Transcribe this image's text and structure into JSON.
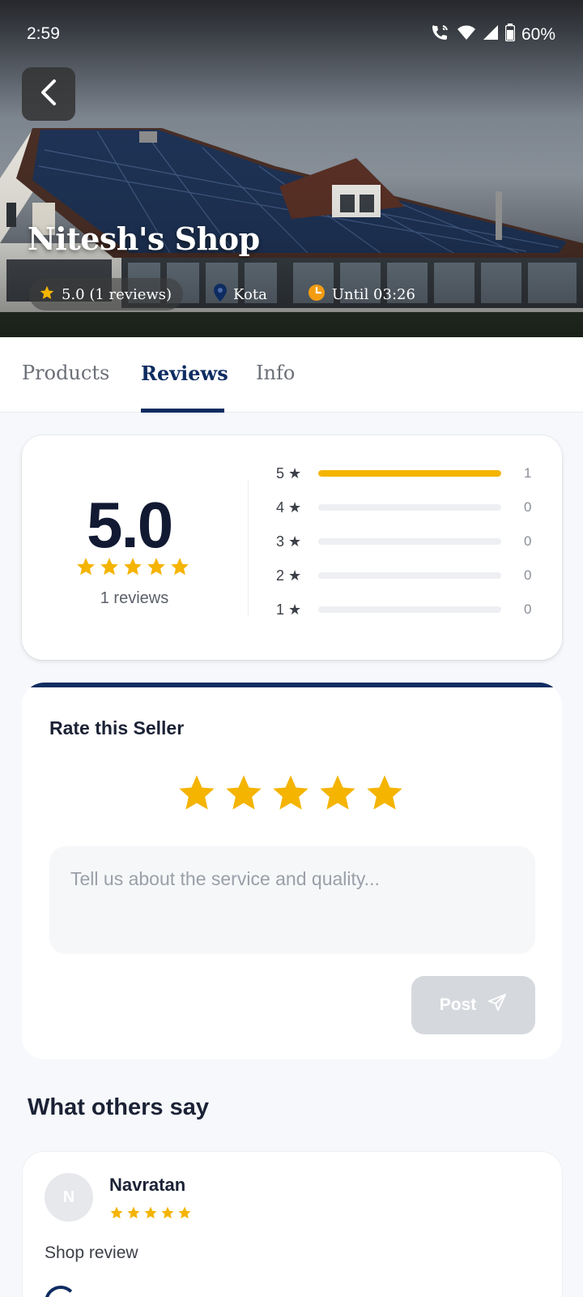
{
  "status_bar": {
    "time": "2:59",
    "battery": "60%"
  },
  "shop": {
    "name": "Nitesh's Shop",
    "rating_chip": "5.0 (1 reviews)",
    "location": "Kota",
    "hours": "Until 03:26"
  },
  "tabs": [
    {
      "label": "Products",
      "active": false
    },
    {
      "label": "Reviews",
      "active": true
    },
    {
      "label": "Info",
      "active": false
    }
  ],
  "summary": {
    "score": "5.0",
    "stars": 5,
    "reviews_label": "1 reviews",
    "breakdown": [
      {
        "label": "5 ★",
        "count": "1",
        "fraction": 1.0
      },
      {
        "label": "4 ★",
        "count": "0",
        "fraction": 0
      },
      {
        "label": "3 ★",
        "count": "0",
        "fraction": 0
      },
      {
        "label": "2 ★",
        "count": "0",
        "fraction": 0
      },
      {
        "label": "1 ★",
        "count": "0",
        "fraction": 0
      }
    ]
  },
  "rate": {
    "title": "Rate this Seller",
    "selected_stars": 5,
    "placeholder": "Tell us about the service and quality...",
    "post_label": "Post"
  },
  "others": {
    "title": "What others say",
    "reviews": [
      {
        "initial": "N",
        "name": "Navratan",
        "stars": 5,
        "text": "Shop review"
      }
    ]
  },
  "colors": {
    "accent": "#0e2c61",
    "star": "#f4b400",
    "clock": "#f39c12"
  }
}
